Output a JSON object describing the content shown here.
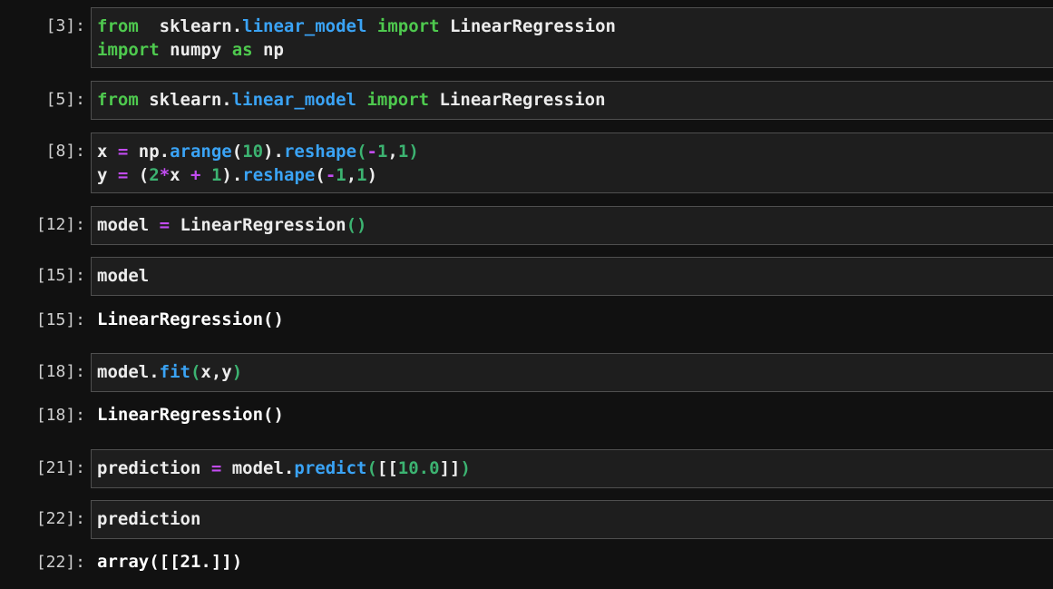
{
  "colors": {
    "background": "#111111",
    "cell_background": "#1e1e1e",
    "cell_border": "#4f4f4f",
    "keyword": "#4ec94e",
    "attribute": "#3aa3f5",
    "number": "#3cb371",
    "operator": "#c34cf2",
    "text": "#ececec"
  },
  "cells": [
    {
      "prompt": "[3]:",
      "lines": [
        [
          {
            "t": "from",
            "c": "kw"
          },
          {
            "t": "  sklearn.",
            "c": "txt"
          },
          {
            "t": "linear_model",
            "c": "attr"
          },
          {
            "t": " ",
            "c": "txt"
          },
          {
            "t": "import",
            "c": "kw"
          },
          {
            "t": " LinearRegression",
            "c": "txt"
          }
        ],
        [
          {
            "t": "import",
            "c": "kw"
          },
          {
            "t": " numpy ",
            "c": "txt"
          },
          {
            "t": "as",
            "c": "kw"
          },
          {
            "t": " np",
            "c": "txt"
          }
        ]
      ]
    },
    {
      "prompt": "[5]:",
      "lines": [
        [
          {
            "t": "from",
            "c": "kw"
          },
          {
            "t": " sklearn.",
            "c": "txt"
          },
          {
            "t": "linear_model",
            "c": "attr"
          },
          {
            "t": " ",
            "c": "txt"
          },
          {
            "t": "import",
            "c": "kw"
          },
          {
            "t": " LinearRegression",
            "c": "txt"
          }
        ]
      ]
    },
    {
      "prompt": "[8]:",
      "lines": [
        [
          {
            "t": "x ",
            "c": "txt"
          },
          {
            "t": "=",
            "c": "op"
          },
          {
            "t": " np.",
            "c": "txt"
          },
          {
            "t": "arange",
            "c": "attr"
          },
          {
            "t": "(",
            "c": "txt"
          },
          {
            "t": "10",
            "c": "num"
          },
          {
            "t": ").",
            "c": "txt"
          },
          {
            "t": "reshape",
            "c": "attr"
          },
          {
            "t": "(",
            "c": "paren"
          },
          {
            "t": "-",
            "c": "op"
          },
          {
            "t": "1",
            "c": "num"
          },
          {
            "t": ",",
            "c": "txt"
          },
          {
            "t": "1",
            "c": "num"
          },
          {
            "t": ")",
            "c": "paren"
          }
        ],
        [
          {
            "t": "y ",
            "c": "txt"
          },
          {
            "t": "=",
            "c": "op"
          },
          {
            "t": " (",
            "c": "txt"
          },
          {
            "t": "2",
            "c": "num"
          },
          {
            "t": "*",
            "c": "op"
          },
          {
            "t": "x ",
            "c": "txt"
          },
          {
            "t": "+",
            "c": "op"
          },
          {
            "t": " ",
            "c": "txt"
          },
          {
            "t": "1",
            "c": "num"
          },
          {
            "t": ").",
            "c": "txt"
          },
          {
            "t": "reshape",
            "c": "attr"
          },
          {
            "t": "(",
            "c": "txt"
          },
          {
            "t": "-",
            "c": "op"
          },
          {
            "t": "1",
            "c": "num"
          },
          {
            "t": ",",
            "c": "txt"
          },
          {
            "t": "1",
            "c": "num"
          },
          {
            "t": ")",
            "c": "txt"
          }
        ]
      ]
    },
    {
      "prompt": "[12]:",
      "lines": [
        [
          {
            "t": "model ",
            "c": "txt"
          },
          {
            "t": "=",
            "c": "op"
          },
          {
            "t": " LinearRegression",
            "c": "txt"
          },
          {
            "t": "()",
            "c": "paren"
          }
        ]
      ]
    },
    {
      "prompt": "[15]:",
      "lines": [
        [
          {
            "t": "model",
            "c": "txt"
          }
        ]
      ],
      "output": {
        "prompt": "[15]:",
        "text": "LinearRegression()"
      }
    },
    {
      "prompt": "[18]:",
      "lines": [
        [
          {
            "t": "model.",
            "c": "txt"
          },
          {
            "t": "fit",
            "c": "attr"
          },
          {
            "t": "(",
            "c": "paren"
          },
          {
            "t": "x,y",
            "c": "txt"
          },
          {
            "t": ")",
            "c": "paren"
          }
        ]
      ],
      "output": {
        "prompt": "[18]:",
        "text": "LinearRegression()"
      }
    },
    {
      "prompt": "[21]:",
      "lines": [
        [
          {
            "t": "prediction ",
            "c": "txt"
          },
          {
            "t": "=",
            "c": "op"
          },
          {
            "t": " model.",
            "c": "txt"
          },
          {
            "t": "predict",
            "c": "attr"
          },
          {
            "t": "(",
            "c": "paren"
          },
          {
            "t": "[[",
            "c": "txt"
          },
          {
            "t": "10.0",
            "c": "num"
          },
          {
            "t": "]]",
            "c": "txt"
          },
          {
            "t": ")",
            "c": "paren"
          }
        ]
      ]
    },
    {
      "prompt": "[22]:",
      "lines": [
        [
          {
            "t": "prediction",
            "c": "txt"
          }
        ]
      ],
      "output": {
        "prompt": "[22]:",
        "text": "array([[21.]])"
      }
    }
  ]
}
